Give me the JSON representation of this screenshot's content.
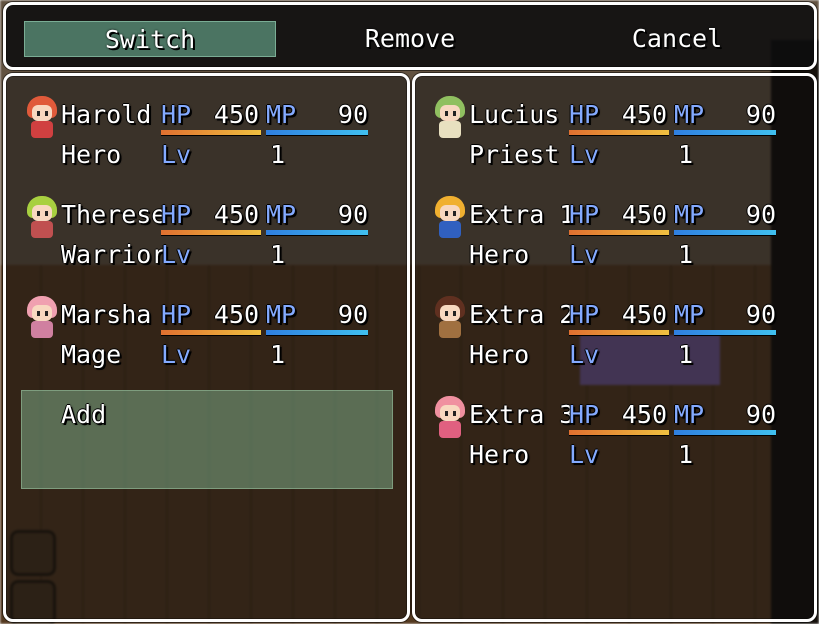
{
  "commands": [
    {
      "label": "Switch",
      "selected": true
    },
    {
      "label": "Remove",
      "selected": false
    },
    {
      "label": "Cancel",
      "selected": false
    }
  ],
  "labels": {
    "hp": "HP",
    "mp": "MP",
    "lv": "Lv"
  },
  "party": [
    {
      "name": "Harold",
      "class": "Hero",
      "hp": "450",
      "mp": "90",
      "level": "1",
      "hp_fill": 1.0,
      "mp_fill": 1.0,
      "hair": "#e05a3a",
      "outfit": "#d04040"
    },
    {
      "name": "Therese",
      "class": "Warrior",
      "hp": "450",
      "mp": "90",
      "level": "1",
      "hp_fill": 1.0,
      "mp_fill": 1.0,
      "hair": "#a8d040",
      "outfit": "#c05050"
    },
    {
      "name": "Marsha",
      "class": "Mage",
      "hp": "450",
      "mp": "90",
      "level": "1",
      "hp_fill": 1.0,
      "mp_fill": 1.0,
      "hair": "#f0a0b0",
      "outfit": "#d080a0"
    }
  ],
  "add_label": "Add",
  "reserve": [
    {
      "name": "Lucius",
      "class": "Priest",
      "hp": "450",
      "mp": "90",
      "level": "1",
      "hp_fill": 1.0,
      "mp_fill": 1.0,
      "hair": "#90c060",
      "outfit": "#e8e0c0"
    },
    {
      "name": "Extra 1",
      "class": "Hero",
      "hp": "450",
      "mp": "90",
      "level": "1",
      "hp_fill": 1.0,
      "mp_fill": 1.0,
      "hair": "#f0b030",
      "outfit": "#3060c0"
    },
    {
      "name": "Extra 2",
      "class": "Hero",
      "hp": "450",
      "mp": "90",
      "level": "1",
      "hp_fill": 1.0,
      "mp_fill": 1.0,
      "hair": "#603020",
      "outfit": "#a07040"
    },
    {
      "name": "Extra 3",
      "class": "Hero",
      "hp": "450",
      "mp": "90",
      "level": "1",
      "hp_fill": 1.0,
      "mp_fill": 1.0,
      "hair": "#f090a0",
      "outfit": "#e06080"
    }
  ]
}
